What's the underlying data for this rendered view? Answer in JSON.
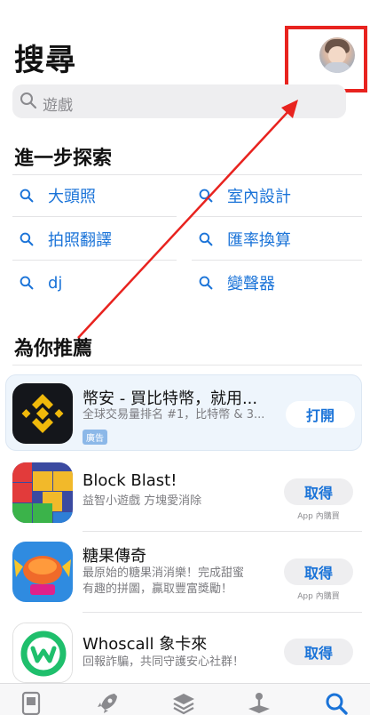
{
  "header": {
    "title": "搜尋"
  },
  "search": {
    "placeholder": "遊戲"
  },
  "explore": {
    "title": "進一步探索",
    "items": [
      {
        "label": "大頭照"
      },
      {
        "label": "室內設計"
      },
      {
        "label": "拍照翻譯"
      },
      {
        "label": "匯率換算"
      },
      {
        "label": "dj"
      },
      {
        "label": "變聲器"
      }
    ]
  },
  "recommend": {
    "title": "為你推薦",
    "apps": [
      {
        "name": "幣安 - 買比特幣，就用...",
        "subtitle": "全球交易量排名 #1，比特幣 & 3...",
        "badge": "廣告",
        "button": "打開",
        "inapp": ""
      },
      {
        "name": "Block Blast!",
        "subtitle": "益智小遊戲 方塊愛消除",
        "badge": "",
        "button": "取得",
        "inapp": "App 內購買"
      },
      {
        "name": "糖果傳奇",
        "subtitle": "最原始的糖果消消樂！完成甜蜜",
        "subtitle2": "有趣的拼圖，贏取豐富獎勵！",
        "badge": "",
        "button": "取得",
        "inapp": "App 內購買"
      },
      {
        "name": "Whoscall 象卡來",
        "subtitle": "回報詐騙，共同守護安心社群！",
        "badge": "",
        "button": "取得",
        "inapp": ""
      }
    ]
  },
  "tabs": [
    {
      "icon": "today-icon"
    },
    {
      "icon": "games-rocket-icon"
    },
    {
      "icon": "apps-stack-icon"
    },
    {
      "icon": "arcade-joystick-icon"
    },
    {
      "icon": "search-icon"
    }
  ],
  "colors": {
    "accent": "#1a73d8",
    "annotation": "#e8231f",
    "adBackground": "#eef5fc"
  }
}
